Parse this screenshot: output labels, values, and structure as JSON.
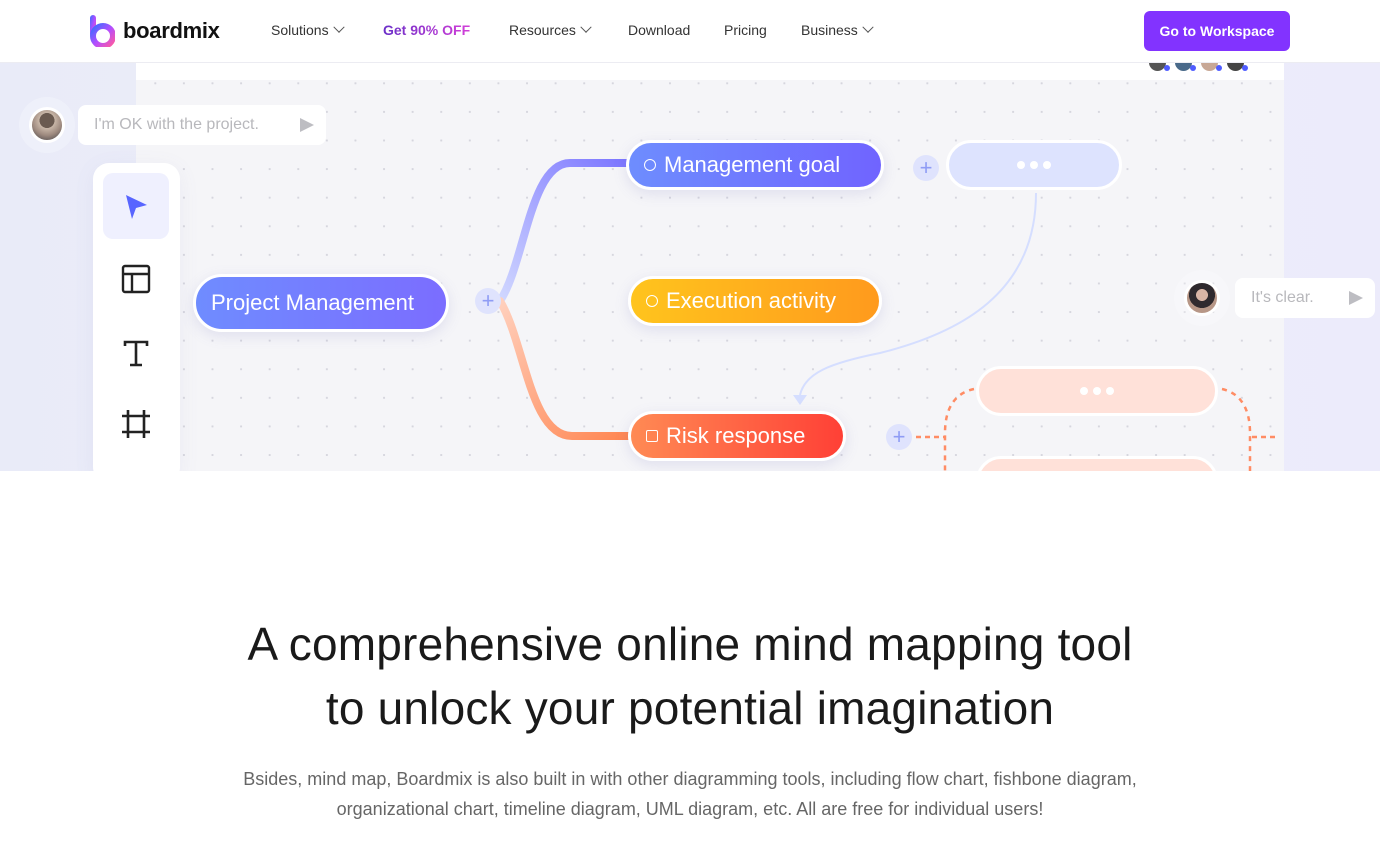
{
  "nav": {
    "brand": "boardmix",
    "items": [
      {
        "label": "Solutions",
        "dropdown": true
      },
      {
        "label": "Get 90% OFF",
        "dropdown": false,
        "promo": true
      },
      {
        "label": "Resources",
        "dropdown": true
      },
      {
        "label": "Download",
        "dropdown": false
      },
      {
        "label": "Pricing",
        "dropdown": false
      },
      {
        "label": "Business",
        "dropdown": true
      }
    ],
    "cta_label": "Go to Workspace",
    "accent_color": "#8233ff"
  },
  "hero": {
    "chat_left": {
      "message": "I'm OK with the project."
    },
    "chat_right": {
      "message": "It's clear."
    },
    "toolbar": {
      "tools": [
        {
          "icon": "cursor-icon",
          "active": true
        },
        {
          "icon": "layout-icon",
          "active": false
        },
        {
          "icon": "text-icon",
          "active": false
        },
        {
          "icon": "frame-icon",
          "active": false
        }
      ]
    },
    "mindmap": {
      "root": "Project Management",
      "branches": [
        {
          "label": "Management goal",
          "icon": "settings-icon",
          "color": "#7064ff"
        },
        {
          "label": "Execution activity",
          "icon": "target-icon",
          "color": "#ffb01d"
        },
        {
          "label": "Risk response",
          "icon": "edit-icon",
          "color": "#ff5a3d"
        }
      ]
    }
  },
  "section": {
    "headline_line1": "A comprehensive online mind mapping tool",
    "headline_line2": "to unlock your potential imagination",
    "description": "Bsides, mind map, Boardmix is also built in with other diagramming tools, including flow chart, fishbone diagram, organizational chart, timeline diagram, UML diagram, etc. All are free for individual users!"
  }
}
